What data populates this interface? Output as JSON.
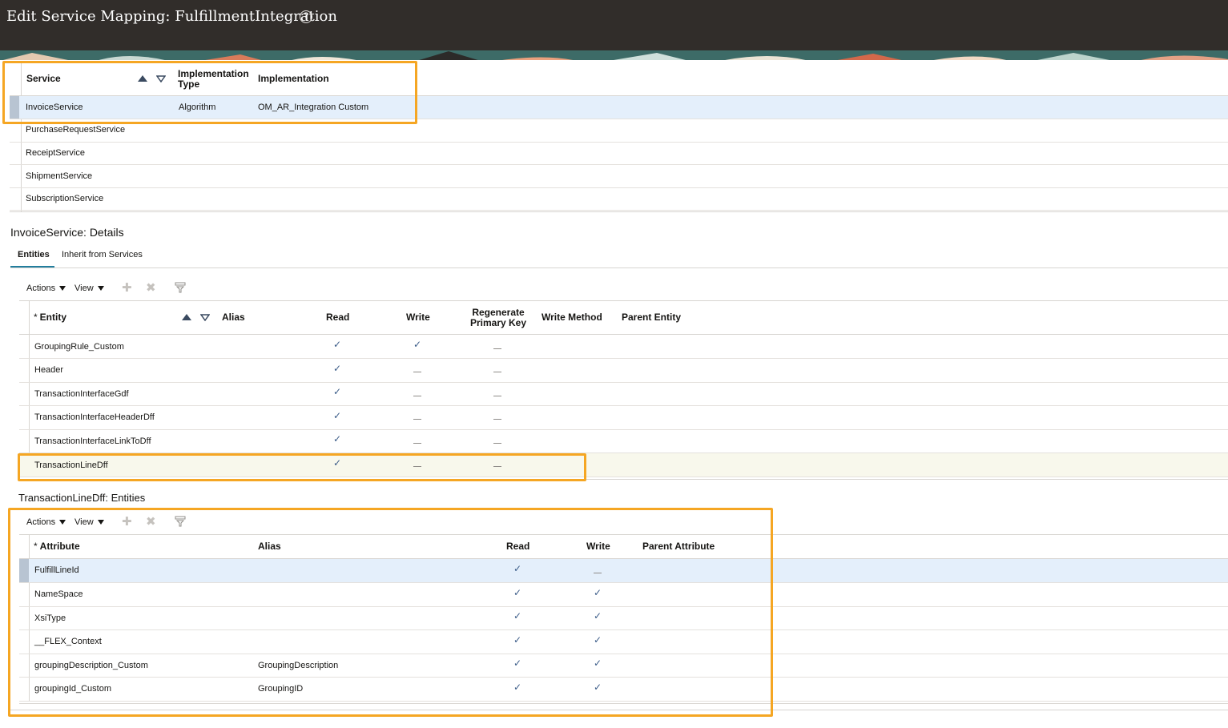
{
  "page": {
    "title": "Edit Service Mapping: FulfillmentIntegration",
    "help_icon": "help-circle-icon"
  },
  "services_table": {
    "headers": {
      "service": "Service",
      "implementation_type": "Implementation Type",
      "implementation": "Implementation"
    },
    "rows": [
      {
        "service": "InvoiceService",
        "implementation_type": "Algorithm",
        "implementation": "OM_AR_Integration Custom",
        "selected": true
      },
      {
        "service": "PurchaseRequestService",
        "implementation_type": "",
        "implementation": ""
      },
      {
        "service": "ReceiptService",
        "implementation_type": "",
        "implementation": ""
      },
      {
        "service": "ShipmentService",
        "implementation_type": "",
        "implementation": ""
      },
      {
        "service": "SubscriptionService",
        "implementation_type": "",
        "implementation": ""
      }
    ]
  },
  "details": {
    "title": "InvoiceService: Details",
    "tabs": [
      {
        "label": "Entities",
        "active": true
      },
      {
        "label": "Inherit from Services",
        "active": false
      }
    ],
    "toolbar": {
      "actions": "Actions",
      "view": "View",
      "add_icon": "add-icon",
      "delete_icon": "delete-icon",
      "filter_icon": "query-by-example-icon"
    },
    "entities_table": {
      "headers": {
        "required_marker": "*",
        "entity": "Entity",
        "alias": "Alias",
        "read": "Read",
        "write": "Write",
        "regenerate_line1": "Regenerate",
        "regenerate_line2": "Primary Key",
        "write_method": "Write Method",
        "parent_entity": "Parent Entity"
      },
      "check_glyph": "✓",
      "rows": [
        {
          "entity": "GroupingRule_Custom",
          "read": true,
          "write": true,
          "regenerate": false
        },
        {
          "entity": "Header",
          "read": true,
          "write": false,
          "regenerate": false
        },
        {
          "entity": "TransactionInterfaceGdf",
          "read": true,
          "write": false,
          "regenerate": false
        },
        {
          "entity": "TransactionInterfaceHeaderDff",
          "read": true,
          "write": false,
          "regenerate": false
        },
        {
          "entity": "TransactionInterfaceLinkToDff",
          "read": true,
          "write": false,
          "regenerate": false
        },
        {
          "entity": "TransactionLineDff",
          "read": true,
          "write": false,
          "regenerate": false,
          "active": true
        }
      ]
    }
  },
  "attributes": {
    "title": "TransactionLineDff: Entities",
    "toolbar": {
      "actions": "Actions",
      "view": "View"
    },
    "headers": {
      "required_marker": "*",
      "attribute": "Attribute",
      "alias": "Alias",
      "read": "Read",
      "write": "Write",
      "parent_attribute": "Parent Attribute"
    },
    "rows": [
      {
        "attribute": "FulfillLineId",
        "alias": "",
        "read": true,
        "write": false,
        "selected": true
      },
      {
        "attribute": "NameSpace",
        "alias": "",
        "read": true,
        "write": true
      },
      {
        "attribute": "XsiType",
        "alias": "",
        "read": true,
        "write": true
      },
      {
        "attribute": "__FLEX_Context",
        "alias": "",
        "read": true,
        "write": true
      },
      {
        "attribute": "groupingDescription_Custom",
        "alias": "GroupingDescription",
        "read": true,
        "write": true
      },
      {
        "attribute": "groupingId_Custom",
        "alias": "GroupingID",
        "read": true,
        "write": true
      }
    ]
  },
  "colors": {
    "header_bg": "#312d2a",
    "highlight_box": "#f5a623",
    "selected_row": "#e4effb",
    "active_row": "#f8f8ec",
    "check": "#3b5c88"
  }
}
